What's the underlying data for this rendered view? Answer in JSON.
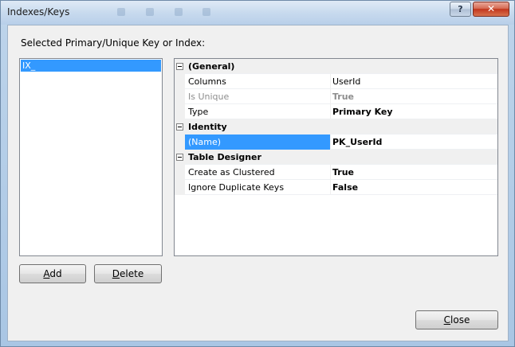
{
  "window": {
    "title": "Indexes/Keys",
    "help_label": "?",
    "close_glyph": "✕"
  },
  "caption": "Selected Primary/Unique Key or Index:",
  "list": {
    "items": [
      {
        "label": "IX_",
        "selected": true
      }
    ]
  },
  "grid": {
    "categories": [
      {
        "label": "(General)",
        "rows": [
          {
            "name": "Columns",
            "value": "UserId",
            "value_bold": false,
            "disabled": false,
            "selected": false
          },
          {
            "name": "Is Unique",
            "value": "True",
            "value_bold": true,
            "disabled": true,
            "selected": false
          },
          {
            "name": "Type",
            "value": "Primary Key",
            "value_bold": true,
            "disabled": false,
            "selected": false
          }
        ]
      },
      {
        "label": "Identity",
        "rows": [
          {
            "name": "(Name)",
            "value": "PK_UserId",
            "value_bold": true,
            "disabled": false,
            "selected": true
          }
        ]
      },
      {
        "label": "Table Designer",
        "rows": [
          {
            "name": "Create as Clustered",
            "value": "True",
            "value_bold": true,
            "disabled": false,
            "selected": false
          },
          {
            "name": "Ignore Duplicate Keys",
            "value": "False",
            "value_bold": true,
            "disabled": false,
            "selected": false
          }
        ]
      }
    ]
  },
  "buttons": {
    "add": {
      "mnemonic": "A",
      "rest": "dd"
    },
    "delete": {
      "mnemonic": "D",
      "rest": "elete"
    },
    "close": {
      "mnemonic": "C",
      "rest": "lose"
    }
  },
  "colors": {
    "selection": "#3399ff",
    "dialog_face": "#f0f0f0",
    "close_button": "#c2361d"
  }
}
